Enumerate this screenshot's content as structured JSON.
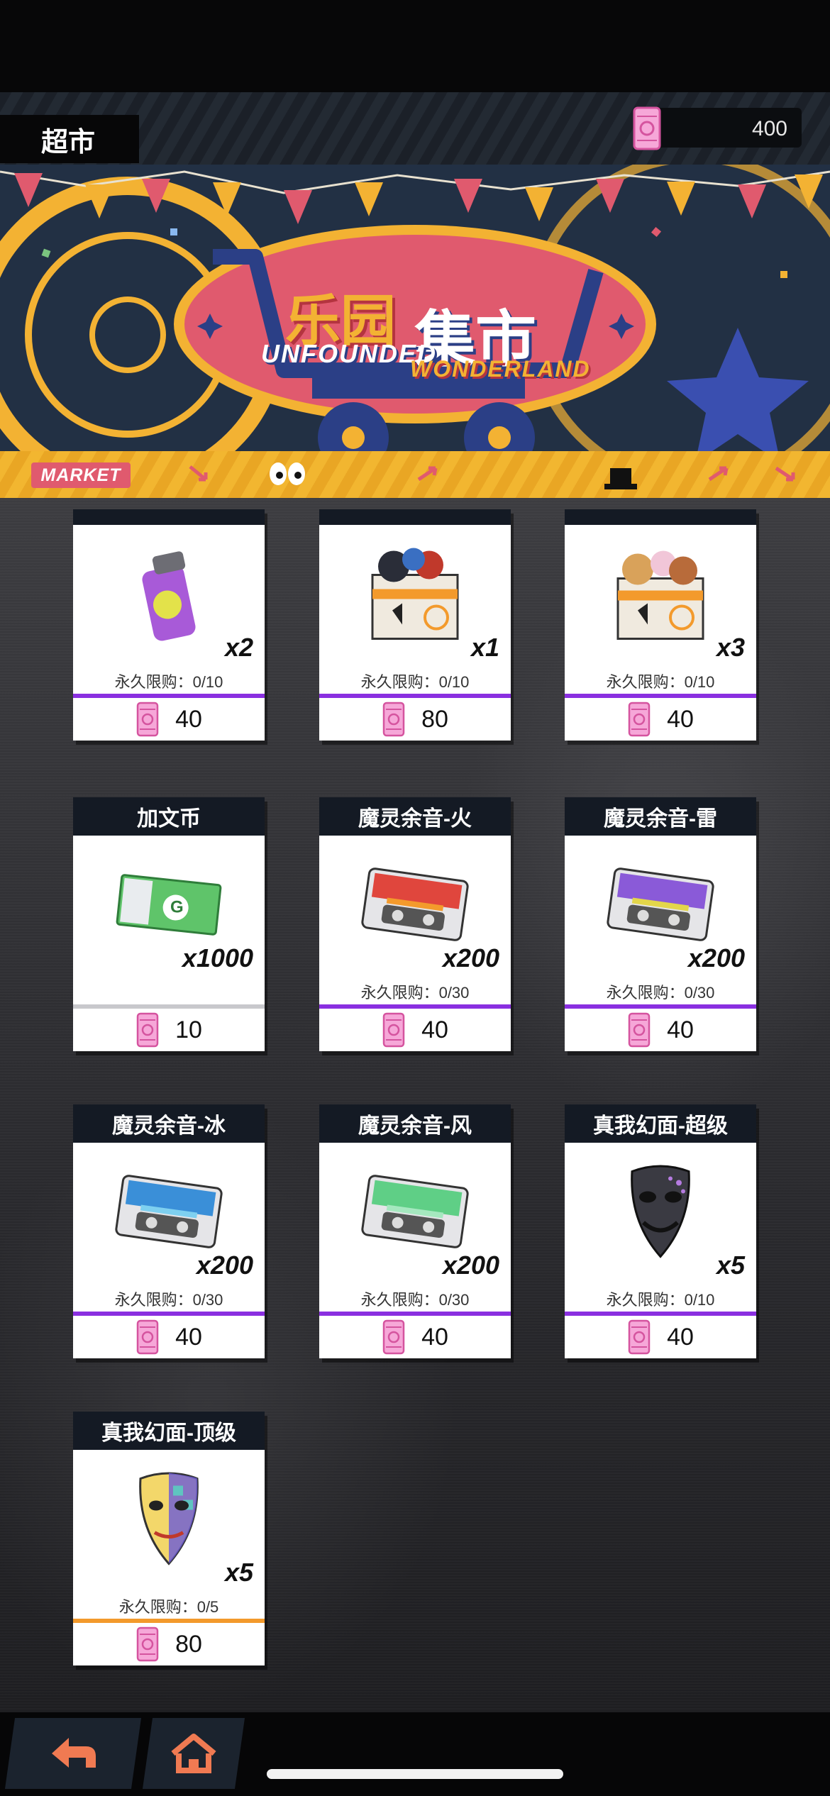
{
  "header": {
    "title": "超市",
    "currency_value": "400"
  },
  "banner": {
    "title_part1": "乐园",
    "title_part2": "集市",
    "subtitle_part1": "UNFOUNDED",
    "subtitle_part2": "WONDERLAND",
    "market_label": "MARKET"
  },
  "shop": {
    "items": [
      {
        "name": "",
        "qty": "x2",
        "limit": "永久限购：0/10",
        "price": "40",
        "bar": "purple",
        "icon": "spray-can-icon"
      },
      {
        "name": "",
        "qty": "x1",
        "limit": "永久限购：0/10",
        "price": "80",
        "bar": "purple",
        "icon": "gift-box-icon"
      },
      {
        "name": "",
        "qty": "x3",
        "limit": "永久限购：0/10",
        "price": "40",
        "bar": "purple",
        "icon": "snack-box-icon"
      },
      {
        "name": "加文币",
        "qty": "x1000",
        "limit": "",
        "price": "10",
        "bar": "grey",
        "icon": "banknote-icon"
      },
      {
        "name": "魔灵余音-火",
        "qty": "x200",
        "limit": "永久限购：0/30",
        "price": "40",
        "bar": "purple",
        "icon": "cassette-fire-icon"
      },
      {
        "name": "魔灵余音-雷",
        "qty": "x200",
        "limit": "永久限购：0/30",
        "price": "40",
        "bar": "purple",
        "icon": "cassette-thunder-icon"
      },
      {
        "name": "魔灵余音-冰",
        "qty": "x200",
        "limit": "永久限购：0/30",
        "price": "40",
        "bar": "purple",
        "icon": "cassette-ice-icon"
      },
      {
        "name": "魔灵余音-风",
        "qty": "x200",
        "limit": "永久限购：0/30",
        "price": "40",
        "bar": "purple",
        "icon": "cassette-wind-icon"
      },
      {
        "name": "真我幻面-超级",
        "qty": "x5",
        "limit": "永久限购：0/10",
        "price": "40",
        "bar": "purple",
        "icon": "dark-mask-icon"
      },
      {
        "name": "真我幻面-顶级",
        "qty": "x5",
        "limit": "永久限购：0/5",
        "price": "80",
        "bar": "orange",
        "icon": "gold-mask-icon"
      }
    ]
  },
  "nav": {
    "back_icon": "back-arrow-icon",
    "home_icon": "home-icon"
  },
  "colors": {
    "accent_purple": "#8a2fe0",
    "accent_orange": "#f39a2c",
    "card_header": "#141a24",
    "ticket_pink": "#f27bc0"
  }
}
